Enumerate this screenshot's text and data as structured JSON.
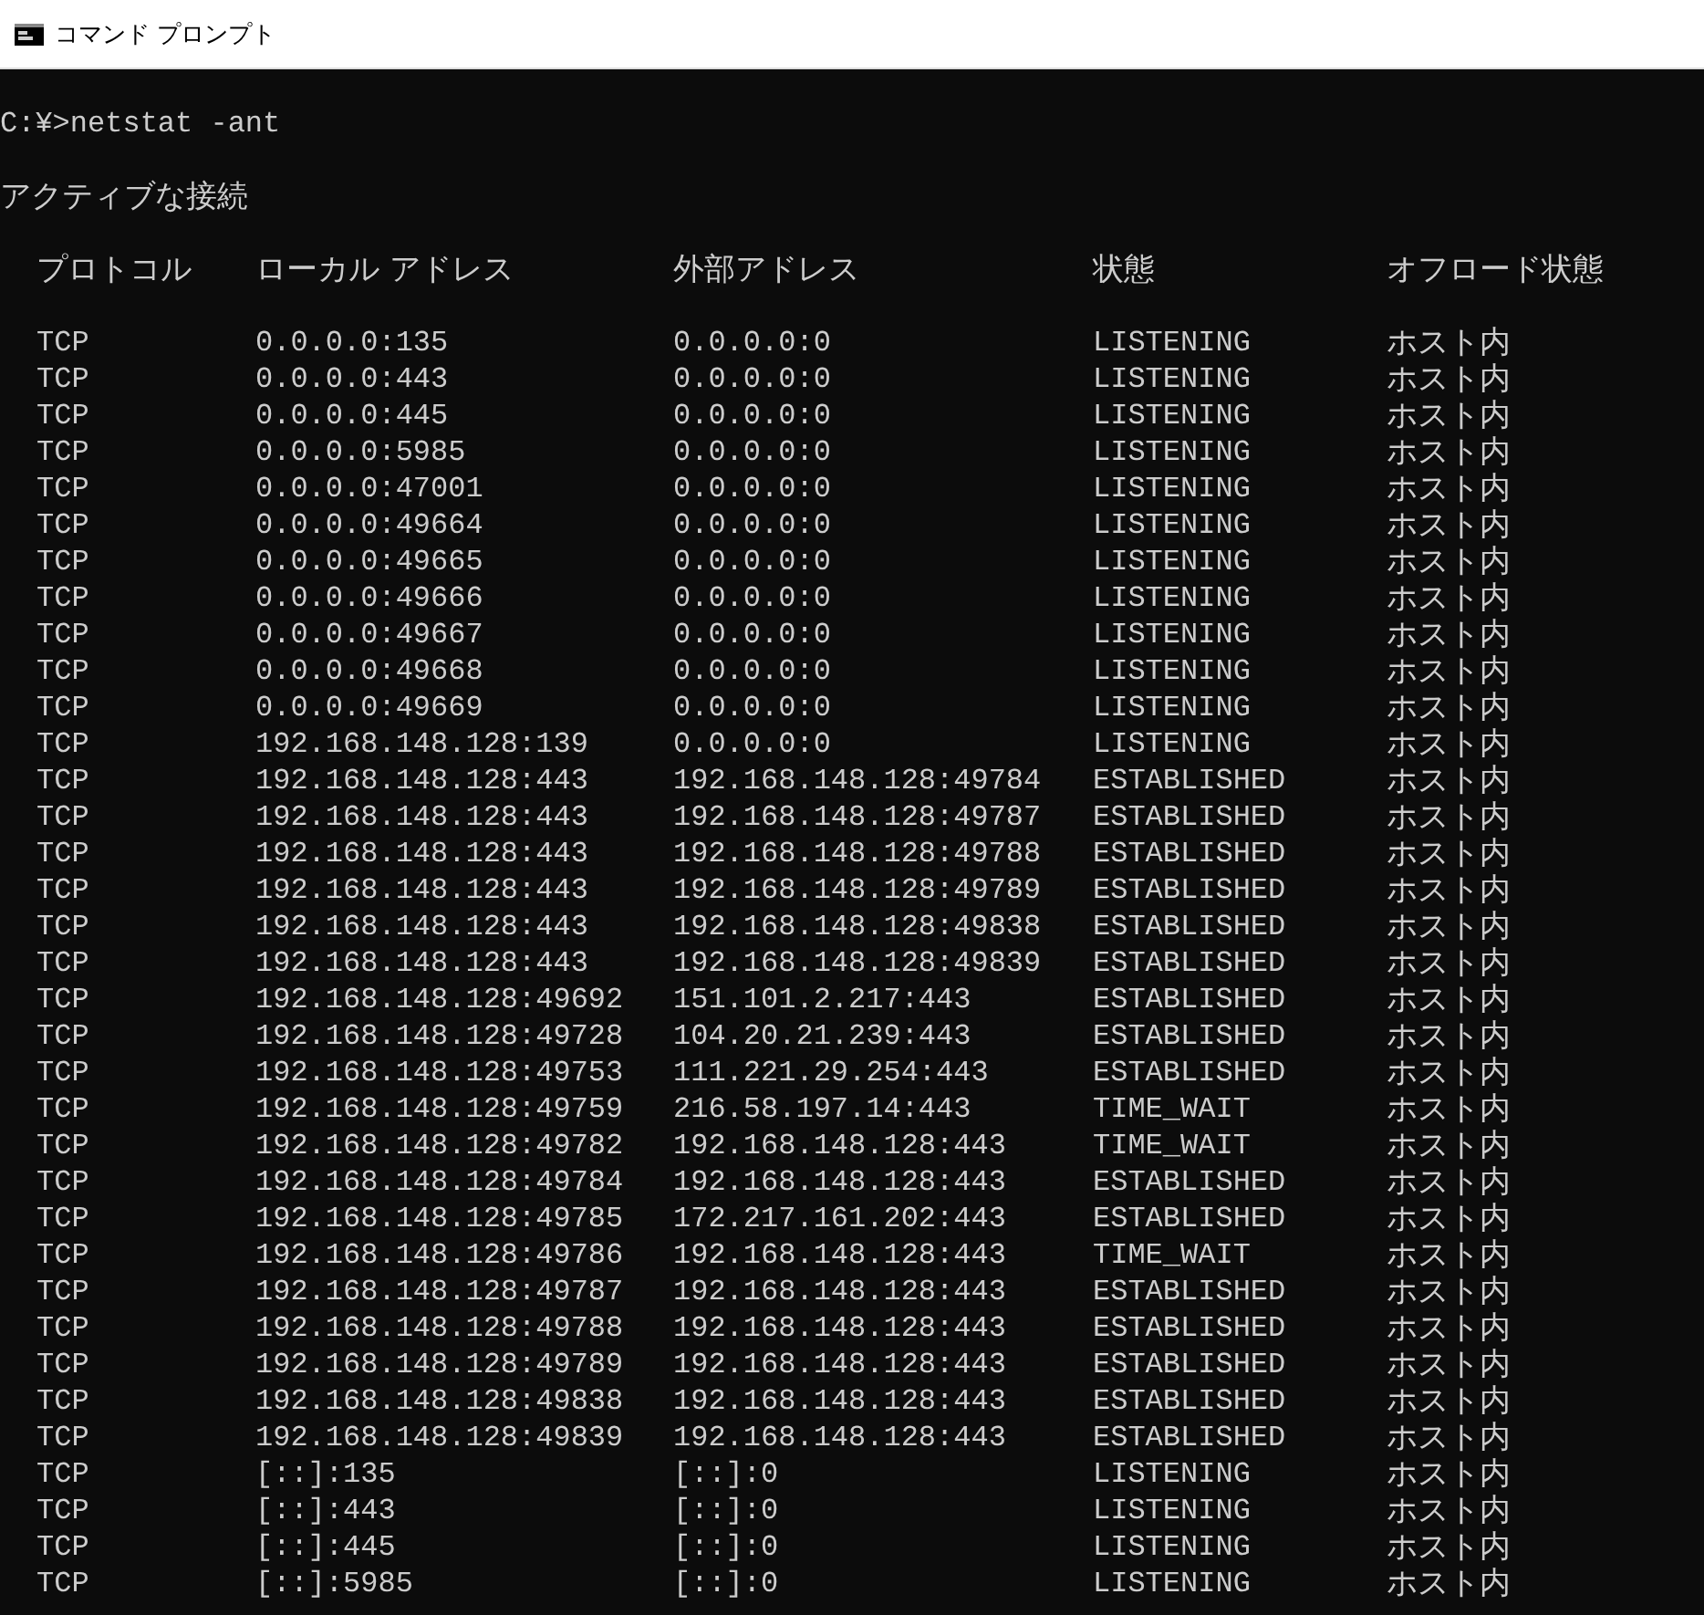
{
  "window": {
    "title": "コマンド プロンプト"
  },
  "console": {
    "command": "C:¥>netstat -ant",
    "heading": "アクティブな接続",
    "columns": [
      "プロトコル",
      "ローカル アドレス",
      "外部アドレス",
      "状態",
      "オフロード状態"
    ],
    "rows": [
      [
        "TCP",
        "0.0.0.0:135",
        "0.0.0.0:0",
        "LISTENING",
        "ホスト内"
      ],
      [
        "TCP",
        "0.0.0.0:443",
        "0.0.0.0:0",
        "LISTENING",
        "ホスト内"
      ],
      [
        "TCP",
        "0.0.0.0:445",
        "0.0.0.0:0",
        "LISTENING",
        "ホスト内"
      ],
      [
        "TCP",
        "0.0.0.0:5985",
        "0.0.0.0:0",
        "LISTENING",
        "ホスト内"
      ],
      [
        "TCP",
        "0.0.0.0:47001",
        "0.0.0.0:0",
        "LISTENING",
        "ホスト内"
      ],
      [
        "TCP",
        "0.0.0.0:49664",
        "0.0.0.0:0",
        "LISTENING",
        "ホスト内"
      ],
      [
        "TCP",
        "0.0.0.0:49665",
        "0.0.0.0:0",
        "LISTENING",
        "ホスト内"
      ],
      [
        "TCP",
        "0.0.0.0:49666",
        "0.0.0.0:0",
        "LISTENING",
        "ホスト内"
      ],
      [
        "TCP",
        "0.0.0.0:49667",
        "0.0.0.0:0",
        "LISTENING",
        "ホスト内"
      ],
      [
        "TCP",
        "0.0.0.0:49668",
        "0.0.0.0:0",
        "LISTENING",
        "ホスト内"
      ],
      [
        "TCP",
        "0.0.0.0:49669",
        "0.0.0.0:0",
        "LISTENING",
        "ホスト内"
      ],
      [
        "TCP",
        "192.168.148.128:139",
        "0.0.0.0:0",
        "LISTENING",
        "ホスト内"
      ],
      [
        "TCP",
        "192.168.148.128:443",
        "192.168.148.128:49784",
        "ESTABLISHED",
        "ホスト内"
      ],
      [
        "TCP",
        "192.168.148.128:443",
        "192.168.148.128:49787",
        "ESTABLISHED",
        "ホスト内"
      ],
      [
        "TCP",
        "192.168.148.128:443",
        "192.168.148.128:49788",
        "ESTABLISHED",
        "ホスト内"
      ],
      [
        "TCP",
        "192.168.148.128:443",
        "192.168.148.128:49789",
        "ESTABLISHED",
        "ホスト内"
      ],
      [
        "TCP",
        "192.168.148.128:443",
        "192.168.148.128:49838",
        "ESTABLISHED",
        "ホスト内"
      ],
      [
        "TCP",
        "192.168.148.128:443",
        "192.168.148.128:49839",
        "ESTABLISHED",
        "ホスト内"
      ],
      [
        "TCP",
        "192.168.148.128:49692",
        "151.101.2.217:443",
        "ESTABLISHED",
        "ホスト内"
      ],
      [
        "TCP",
        "192.168.148.128:49728",
        "104.20.21.239:443",
        "ESTABLISHED",
        "ホスト内"
      ],
      [
        "TCP",
        "192.168.148.128:49753",
        "111.221.29.254:443",
        "ESTABLISHED",
        "ホスト内"
      ],
      [
        "TCP",
        "192.168.148.128:49759",
        "216.58.197.14:443",
        "TIME_WAIT",
        "ホスト内"
      ],
      [
        "TCP",
        "192.168.148.128:49782",
        "192.168.148.128:443",
        "TIME_WAIT",
        "ホスト内"
      ],
      [
        "TCP",
        "192.168.148.128:49784",
        "192.168.148.128:443",
        "ESTABLISHED",
        "ホスト内"
      ],
      [
        "TCP",
        "192.168.148.128:49785",
        "172.217.161.202:443",
        "ESTABLISHED",
        "ホスト内"
      ],
      [
        "TCP",
        "192.168.148.128:49786",
        "192.168.148.128:443",
        "TIME_WAIT",
        "ホスト内"
      ],
      [
        "TCP",
        "192.168.148.128:49787",
        "192.168.148.128:443",
        "ESTABLISHED",
        "ホスト内"
      ],
      [
        "TCP",
        "192.168.148.128:49788",
        "192.168.148.128:443",
        "ESTABLISHED",
        "ホスト内"
      ],
      [
        "TCP",
        "192.168.148.128:49789",
        "192.168.148.128:443",
        "ESTABLISHED",
        "ホスト内"
      ],
      [
        "TCP",
        "192.168.148.128:49838",
        "192.168.148.128:443",
        "ESTABLISHED",
        "ホスト内"
      ],
      [
        "TCP",
        "192.168.148.128:49839",
        "192.168.148.128:443",
        "ESTABLISHED",
        "ホスト内"
      ],
      [
        "TCP",
        "[::]:135",
        "[::]:0",
        "LISTENING",
        "ホスト内"
      ],
      [
        "TCP",
        "[::]:443",
        "[::]:0",
        "LISTENING",
        "ホスト内"
      ],
      [
        "TCP",
        "[::]:445",
        "[::]:0",
        "LISTENING",
        "ホスト内"
      ],
      [
        "TCP",
        "[::]:5985",
        "[::]:0",
        "LISTENING",
        "ホスト内"
      ]
    ]
  }
}
